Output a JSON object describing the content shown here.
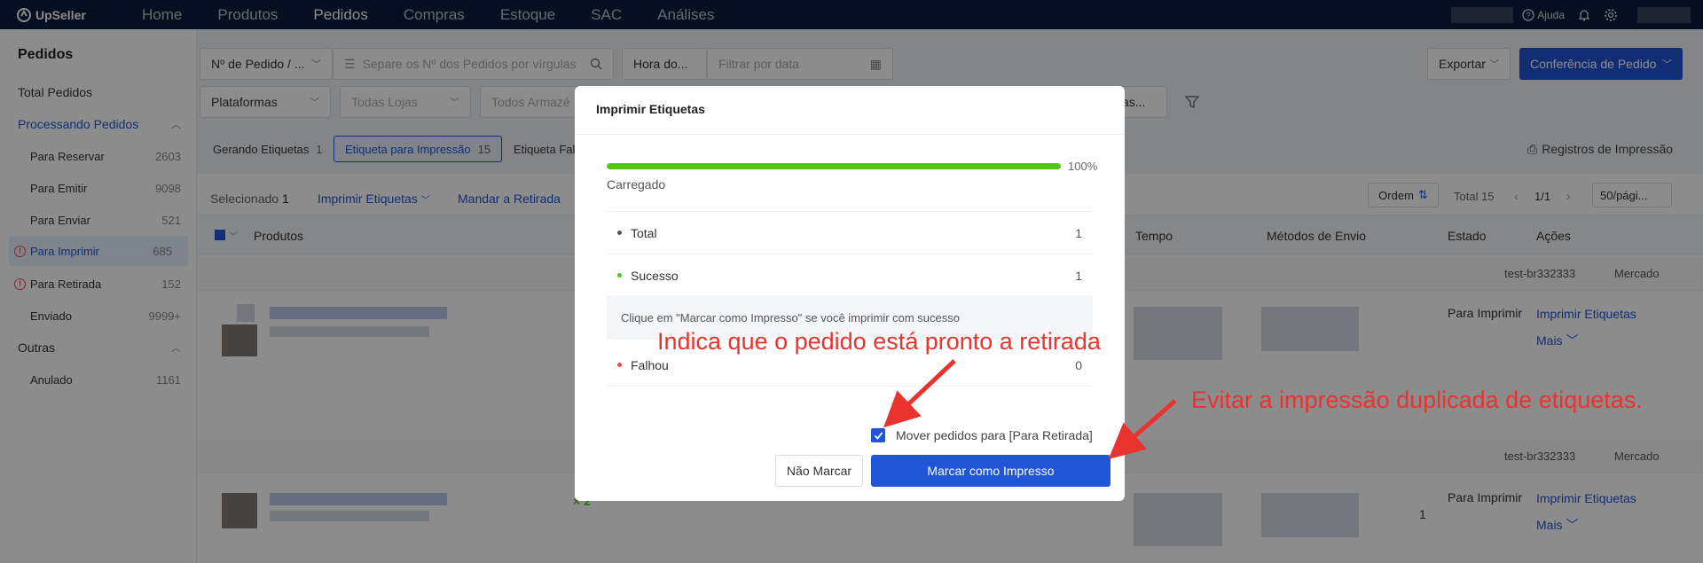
{
  "topnav": {
    "brand": "UpSeller",
    "items": [
      "Home",
      "Produtos",
      "Pedidos",
      "Compras",
      "Estoque",
      "SAC",
      "Análises"
    ],
    "active": "Pedidos",
    "help_label": "Ajuda"
  },
  "sidebar": {
    "title": "Pedidos",
    "total": "Total Pedidos",
    "processing_label": "Processando Pedidos",
    "items": [
      {
        "label": "Para Reservar",
        "count": "2603"
      },
      {
        "label": "Para Emitir",
        "count": "9098"
      },
      {
        "label": "Para Enviar",
        "count": "521"
      },
      {
        "label": "Para Imprimir",
        "count": "685"
      },
      {
        "label": "Para Retirada",
        "count": "152"
      },
      {
        "label": "Enviado",
        "count": "9999+"
      }
    ],
    "others_label": "Outras",
    "others": [
      {
        "label": "Anulado",
        "count": "1161"
      }
    ]
  },
  "filters": {
    "order_type": "Nº de Pedido / ...",
    "search_placeholder": "Separe os Nº dos Pedidos por vírgulas",
    "time_type": "Hora do...",
    "date_placeholder": "Filtrar por data",
    "platforms": "Plataformas",
    "stores": "Todas Lojas",
    "warehouses": "Todos Armazé",
    "right_partial": "as..."
  },
  "actions": {
    "export": "Exportar",
    "conference": "Conferência de Pedido"
  },
  "tabs": [
    {
      "label": "Gerando Etiquetas",
      "count": "1"
    },
    {
      "label": "Etiqueta para Impressão",
      "count": "15"
    },
    {
      "label": "Etiqueta Fal",
      "count": ""
    }
  ],
  "print_records": "Registros de Impressão",
  "toolbar": {
    "selected_label": "Selecionado",
    "selected_count": "1",
    "print_labels": "Imprimir Etiquetas",
    "send_pickup": "Mandar a Retirada",
    "order": "Ordem",
    "total": "Total 15",
    "page": "1/1",
    "per_page": "50/pági..."
  },
  "table": {
    "headers": {
      "products": "Produtos",
      "time": "Tempo",
      "shipping": "Métodos de Envio",
      "state": "Estado",
      "actions": "Ações"
    },
    "rows": [
      {
        "store": "test-br332333",
        "channel": "Mercado",
        "state": "Para Imprimir",
        "action1": "Imprimir Etiquetas",
        "action2": "Mais"
      },
      {
        "store": "test-br332333",
        "channel": "Mercado",
        "state": "Para Imprimir",
        "action1": "Imprimir Etiquetas",
        "action2": "Mais",
        "qty": "× 2",
        "qty2": "1"
      }
    ]
  },
  "modal": {
    "title": "Imprimir Etiquetas",
    "progress": 100,
    "progress_label": "100%",
    "loaded": "Carregado",
    "total_label": "Total",
    "total_value": "1",
    "success_label": "Sucesso",
    "success_value": "1",
    "note": "Clique em \"Marcar como Impresso\" se você imprimir com sucesso",
    "failed_label": "Falhou",
    "failed_value": "0",
    "checkbox_label": "Mover pedidos para [Para Retirada]",
    "cancel": "Não Marcar",
    "confirm": "Marcar como Impresso",
    "colors": {
      "success": "#52c41a",
      "failed": "#e84a4a",
      "primary": "#1f55d6"
    }
  },
  "annotations": {
    "a1": "Indica que o pedido está pronto a retirada",
    "a2": "Evitar a impressão duplicada de etiquetas."
  }
}
